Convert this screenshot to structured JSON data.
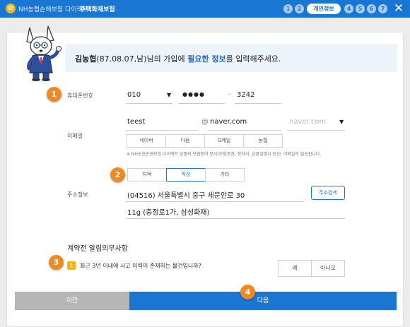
{
  "header": {
    "logo_glyph": "✿",
    "brand": "NH농협손해보험 다이렉트",
    "product": "주택화재보험",
    "steps": [
      "1",
      "2",
      "4",
      "5",
      "6",
      "7"
    ],
    "active_step": "개인정보",
    "close_glyph": "✕",
    "bg_color": "#1976d2"
  },
  "banner": {
    "name": "김농협",
    "info": "(87.08.07,남)님의 가입에 ",
    "highlight": "필요한 정보",
    "suffix": "를 입력해주세요."
  },
  "badges": [
    "1",
    "2",
    "3",
    "4"
  ],
  "phone": {
    "label": "휴대폰번호",
    "prefix": "010",
    "masked": "●●●●",
    "dash": "-",
    "last": "3242"
  },
  "email": {
    "label": "이메일",
    "local": "teest",
    "at": "@",
    "domain": "naver.com",
    "domain_select_placeholder": "naver.com",
    "providers": [
      "네이버",
      "다음",
      "G메일",
      "농협"
    ],
    "note": "※ NH농협손해보험 다이렉트 상품의 보험청약 문서(보험증권, 청약서, 상품설명서 등)는 이메일로 발송됩니다."
  },
  "address": {
    "label": "주소정보",
    "types": [
      "자택",
      "직장",
      "기타"
    ],
    "selected_type": "직장",
    "line1": "(04516) 서울특별시 중구 세문안로 30",
    "line2": "11g (충정로1가, 삼성화재)",
    "search_button": "주소검색"
  },
  "notice": {
    "title": "계약전 알림의무사항",
    "question_number": "1",
    "question": "최근 3년 이내에 사고 이력이 존재하는 물건입니까?",
    "yes": "예",
    "no": "아니오"
  },
  "footer": {
    "prev": "이전",
    "next": "다음"
  },
  "colors": {
    "accent": "#1976d2",
    "badge": "#ef8a23",
    "question_badge": "#f5b21a",
    "prev_button": "#b6b6b6"
  }
}
